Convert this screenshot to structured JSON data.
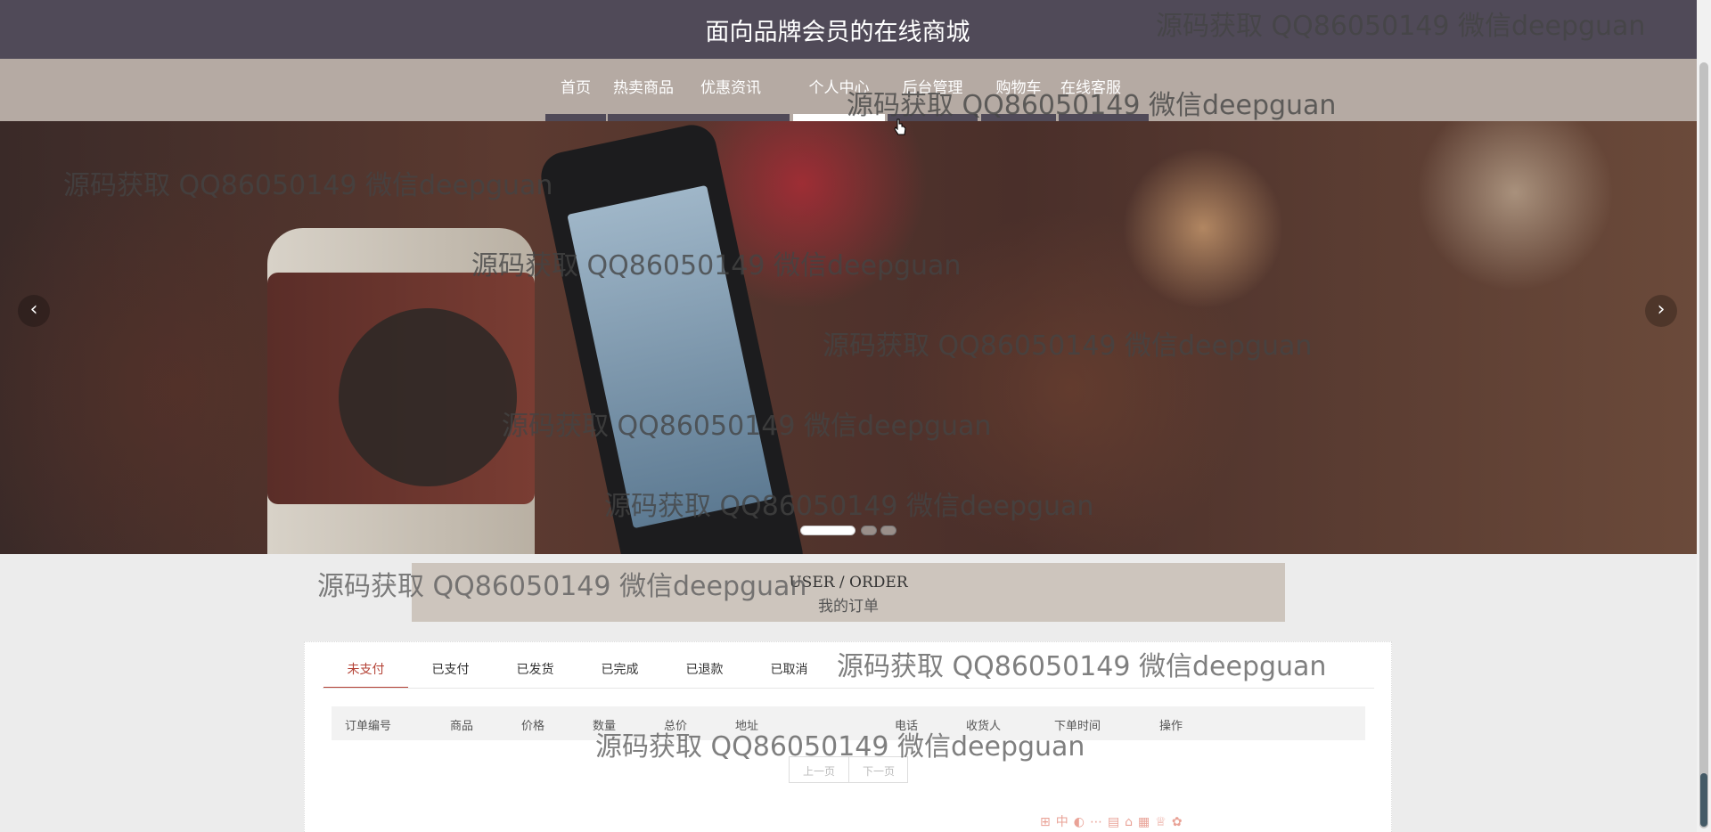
{
  "header": {
    "title": "面向品牌会员的在线商城"
  },
  "nav": {
    "items": [
      {
        "label": "首页"
      },
      {
        "label": "热卖商品"
      },
      {
        "label": "优惠资讯"
      },
      {
        "label": "个人中心"
      },
      {
        "label": "后台管理"
      },
      {
        "label": "购物车"
      },
      {
        "label": "在线客服"
      }
    ],
    "active_index": 3
  },
  "banner": {
    "prev_glyph": "‹",
    "next_glyph": "›",
    "slides": 3,
    "active_slide": 1
  },
  "section": {
    "title_en": "USER / ORDER",
    "title_cn": "我的订单"
  },
  "orders": {
    "tabs": [
      {
        "label": "未支付"
      },
      {
        "label": "已支付"
      },
      {
        "label": "已发货"
      },
      {
        "label": "已完成"
      },
      {
        "label": "已退款"
      },
      {
        "label": "已取消"
      }
    ],
    "active_tab": 0,
    "columns": [
      "订单编号",
      "商品",
      "价格",
      "数量",
      "总价",
      "地址",
      "电话",
      "收货人",
      "下单时间",
      "操作"
    ],
    "pager": {
      "prev": "上一页",
      "next": "下一页"
    }
  },
  "watermark": "源码获取 QQ86050149 微信deepguan",
  "colors": {
    "topbar": "#504a58",
    "navbar": "#b5aaa3",
    "accent": "#b44236",
    "section_bg": "#cdc5bd"
  },
  "icons": [
    "chevron-left-icon",
    "chevron-right-icon",
    "cursor-hand-icon",
    "ime-toolbar"
  ]
}
